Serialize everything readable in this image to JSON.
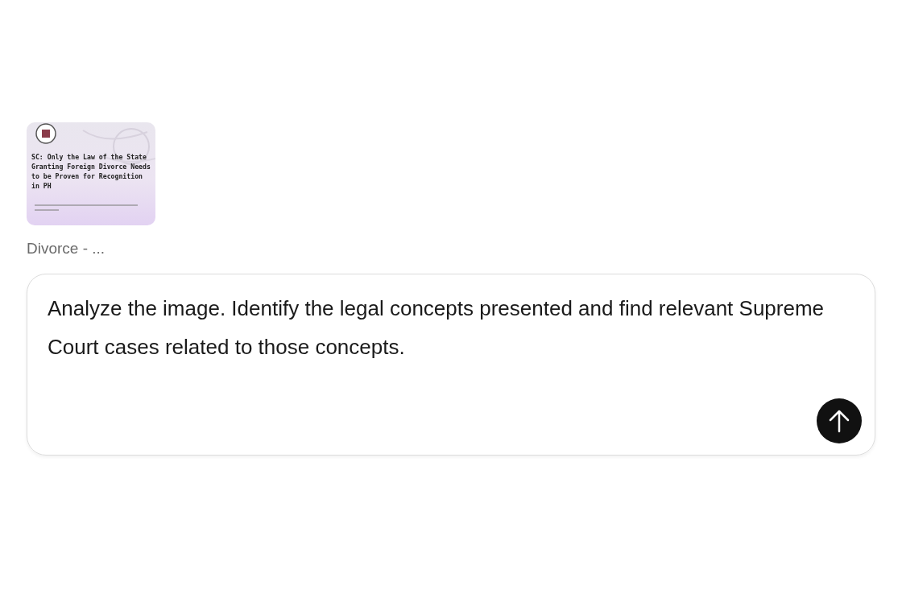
{
  "attachment": {
    "heading": "SC: Only the Law of the State Granting Foreign Divorce Needs to be Proven for Recognition in PH",
    "label": "Divorce - ..."
  },
  "composer": {
    "value": "Analyze the image. Identify the legal concepts presented and find relevant Supreme Court cases related to those concepts.",
    "send_disabled": false
  }
}
